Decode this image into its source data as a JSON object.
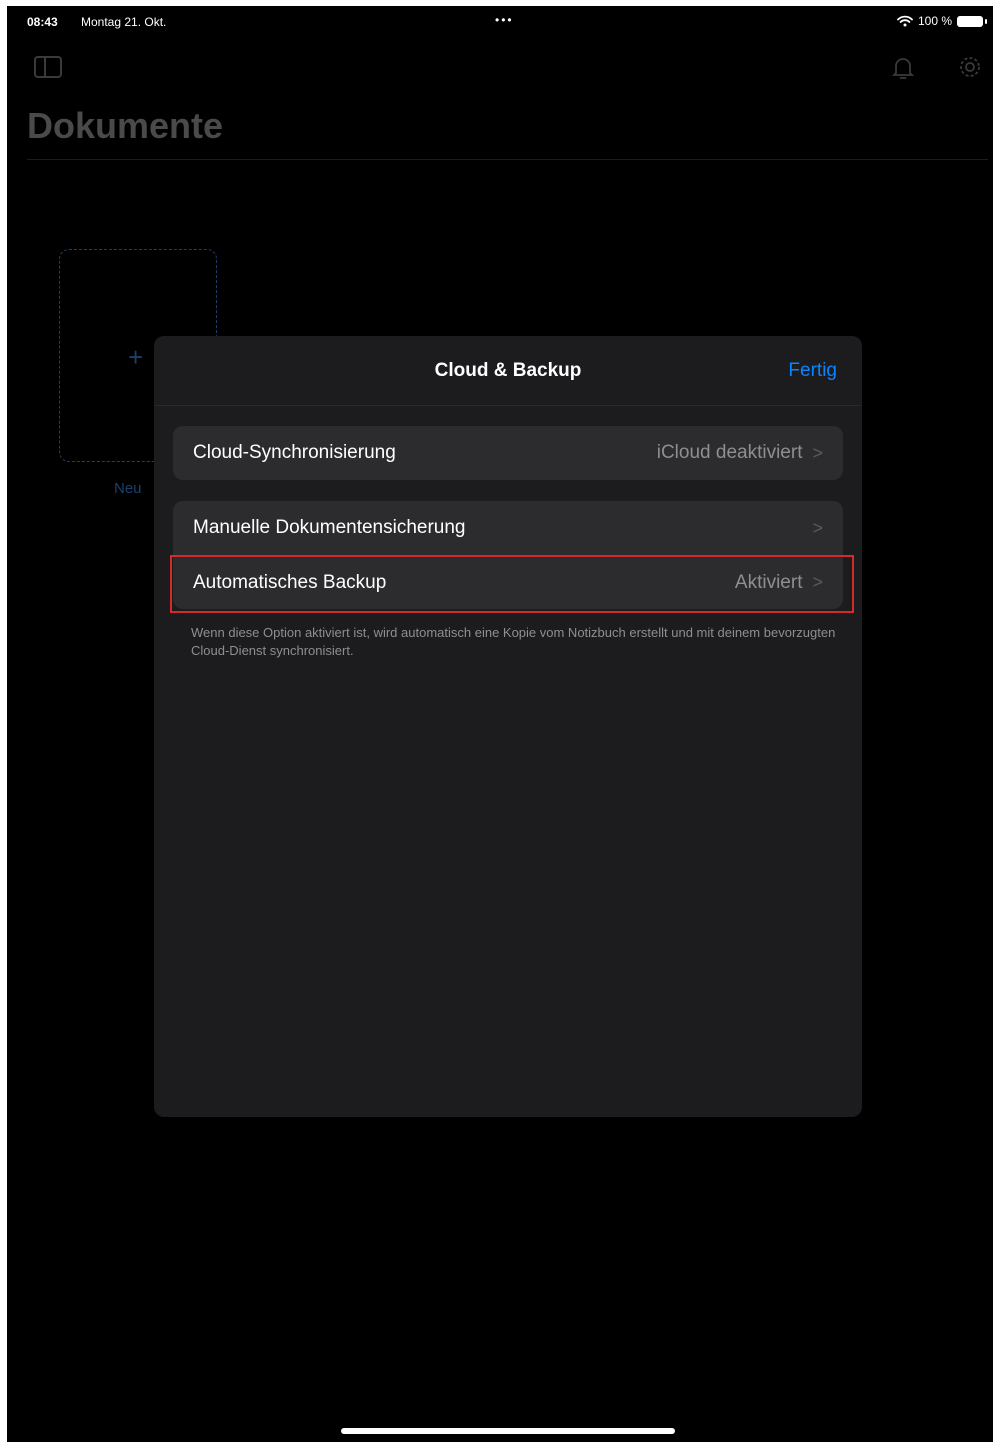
{
  "status_bar": {
    "time": "08:43",
    "date": "Montag 21. Okt.",
    "dots": "•••",
    "battery_text": "100 %",
    "icons": [
      "wifi-icon",
      "battery-icon"
    ]
  },
  "background": {
    "page_title": "Dokumente",
    "new_document_label": "Neu",
    "new_document_plus": "+",
    "icons": [
      "sidebar-toggle-icon",
      "bell-icon",
      "gear-icon"
    ]
  },
  "sheet": {
    "title": "Cloud & Backup",
    "done_label": "Fertig",
    "groups": [
      {
        "rows": [
          {
            "label": "Cloud-Synchronisierung",
            "value": "iCloud deaktiviert"
          }
        ]
      },
      {
        "rows": [
          {
            "label": "Manuelle Dokumentensicherung",
            "value": ""
          },
          {
            "label": "Automatisches Backup",
            "value": "Aktiviert"
          }
        ],
        "footer": "Wenn diese Option aktiviert ist, wird automatisch eine Kopie vom Notizbuch erstellt und mit deinem bevorzugten Cloud-Dienst synchronisiert."
      }
    ],
    "chevron": ">"
  },
  "colors": {
    "accent": "#0a84ff",
    "highlight": "#d42a2a",
    "sheet_bg": "#1c1c1e",
    "row_bg": "#2c2c2e"
  }
}
